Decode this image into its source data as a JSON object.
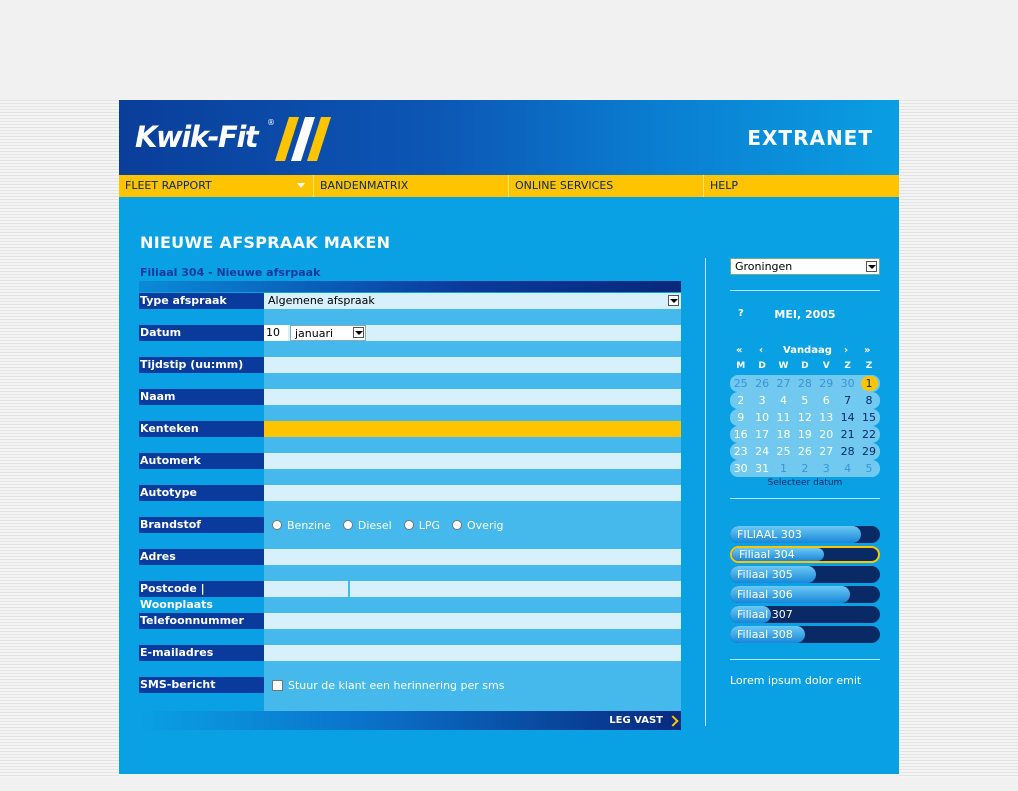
{
  "header": {
    "logo_text": "Kwik-Fit",
    "logo_reg": "®",
    "title": "EXTRANET"
  },
  "nav": [
    {
      "label": "FLEET RAPPORT",
      "has_dropdown": true
    },
    {
      "label": "BANDENMATRIX",
      "has_dropdown": false
    },
    {
      "label": "ONLINE SERVICES",
      "has_dropdown": false
    },
    {
      "label": "HELP",
      "has_dropdown": false
    }
  ],
  "page_title": "NIEUWE AFSPRAAK MAKEN",
  "form": {
    "header": "Filiaal 304 - Nieuwe afsrpaak",
    "labels": {
      "type": "Type afspraak",
      "datum": "Datum",
      "tijdstip": "Tijdstip (uu:mm)",
      "naam": "Naam",
      "kenteken": "Kenteken",
      "automerk": "Automerk",
      "autotype": "Autotype",
      "brandstof": "Brandstof",
      "adres": "Adres",
      "postcode": "Postcode | Woonplaats",
      "telefoon": "Telefoonnummer",
      "email": "E-mailadres",
      "sms": "SMS-bericht"
    },
    "type_value": "Algemene afspraak",
    "datum_day": "10",
    "datum_month": "januari",
    "fuel_options": [
      "Benzine",
      "Diesel",
      "LPG",
      "Overig"
    ],
    "sms_checkbox_label": "Stuur de klant een herinnering per sms",
    "submit_label": "LEG VAST"
  },
  "sidebar": {
    "city": "Groningen",
    "calendar": {
      "help": "?",
      "month": "MEI, 2005",
      "nav": {
        "prev_year": "«",
        "prev_month": "‹",
        "today": "Vandaag",
        "next_month": "›",
        "next_year": "»"
      },
      "weekdays": [
        "M",
        "D",
        "W",
        "D",
        "V",
        "Z",
        "Z"
      ],
      "weeks": [
        [
          "25",
          "26",
          "27",
          "28",
          "29",
          "30",
          "1"
        ],
        [
          "2",
          "3",
          "4",
          "5",
          "6",
          "7",
          "8"
        ],
        [
          "9",
          "10",
          "11",
          "12",
          "13",
          "14",
          "15"
        ],
        [
          "16",
          "17",
          "18",
          "19",
          "20",
          "21",
          "22"
        ],
        [
          "23",
          "24",
          "25",
          "26",
          "27",
          "28",
          "29"
        ],
        [
          "30",
          "31",
          "1",
          "2",
          "3",
          "4",
          "5"
        ]
      ],
      "selected_day": "1",
      "footer": "Selecteer datum"
    },
    "branches": [
      {
        "label": "FILIAAL 303",
        "load": 0.87,
        "active": false
      },
      {
        "label": "Filiaal 304",
        "load": 0.63,
        "active": true
      },
      {
        "label": "Filiaal 305",
        "load": 0.57,
        "active": false
      },
      {
        "label": "Filiaal 306",
        "load": 0.8,
        "active": false
      },
      {
        "label": "Filiaal 307",
        "load": 0.27,
        "active": false
      },
      {
        "label": "Filiaal 308",
        "load": 0.5,
        "active": false
      }
    ],
    "lorem": "Lorem ipsum dolor emit"
  },
  "colors": {
    "primary_blue": "#0aa0e4",
    "dark_blue": "#0a3a9c",
    "accent_yellow": "#ffc400"
  }
}
